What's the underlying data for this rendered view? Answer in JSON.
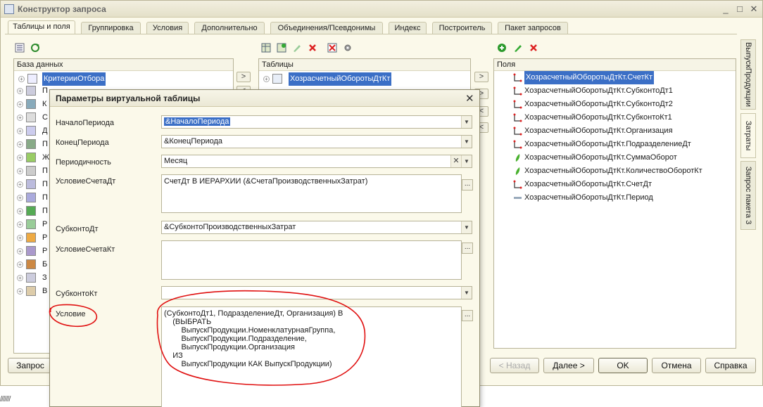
{
  "window": {
    "title": "Конструктор запроса",
    "minimize": "_",
    "maximize": "□",
    "close": "✕"
  },
  "tabs": [
    "Таблицы и поля",
    "Группировка",
    "Условия",
    "Дополнительно",
    "Объединения/Псевдонимы",
    "Индекс",
    "Построитель",
    "Пакет запросов"
  ],
  "database_panel": {
    "header": "База данных",
    "first_item": "КритерииОтбора",
    "items_visible": [
      "П",
      "К",
      "С",
      "Д",
      "П",
      "Ж",
      "П",
      "П",
      "П",
      "П",
      "Р",
      "Р",
      "Р",
      "Б",
      "З",
      "В"
    ]
  },
  "tables_panel": {
    "header": "Таблицы",
    "item": "ХозрасчетныйОборотыДтКт"
  },
  "fields_panel": {
    "header": "Поля",
    "items": [
      "ХозрасчетныйОборотыДтКт.СчетКт",
      "ХозрасчетныйОборотыДтКт.СубконтоДт1",
      "ХозрасчетныйОборотыДтКт.СубконтоДт2",
      "ХозрасчетныйОборотыДтКт.СубконтоКт1",
      "ХозрасчетныйОборотыДтКт.Организация",
      "ХозрасчетныйОборотыДтКт.ПодразделениеДт",
      "ХозрасчетныйОборотыДтКт.СуммаОборот",
      "ХозрасчетныйОборотыДтКт.КоличествоОборотКт",
      "ХозрасчетныйОборотыДтКт.СчетДт",
      "ХозрасчетныйОборотыДтКт.Период"
    ]
  },
  "side_tabs": [
    "ВыпускПродукции",
    "Затраты",
    "Запрос пакета 3"
  ],
  "arrows": {
    "right": ">",
    "left": "<"
  },
  "buttons": {
    "query": "Запрос",
    "back": "< Назад",
    "next": "Далее >",
    "ok": "OK",
    "cancel": "Отмена",
    "help": "Справка"
  },
  "dialog": {
    "title": "Параметры виртуальной таблицы",
    "close": "✕",
    "params": {
      "start_label": "НачалоПериода",
      "start_value": "&НачалоПериода",
      "end_label": "КонецПериода",
      "end_value": "&КонецПериода",
      "periodicity_label": "Периодичность",
      "periodicity_value": "Месяц",
      "acc_dt_label": "УсловиеСчетаДт",
      "acc_dt_value": "СчетДт В ИЕРАРХИИ (&СчетаПроизводственныхЗатрат)",
      "subconto_dt_label": "СубконтоДт",
      "subconto_dt_value": "&СубконтоПроизводственныхЗатрат",
      "acc_kt_label": "УсловиеСчетаКт",
      "acc_kt_value": "",
      "subconto_kt_label": "СубконтоКт",
      "subconto_kt_value": "",
      "condition_label": "Условие",
      "condition_value": "(СубконтоДт1, ПодразделениеДт, Организация) В\n    (ВЫБРАТЬ\n        ВыпускПродукции.НоменклатурнаяГруппа,\n        ВыпускПродукции.Подразделение,\n        ВыпускПродукции.Организация\n    ИЗ\n        ВыпускПродукции КАК ВыпускПродукции)"
    },
    "dots": "...",
    "dropdown": "▼",
    "clear": "✕"
  },
  "annotation_color": "#e01010"
}
